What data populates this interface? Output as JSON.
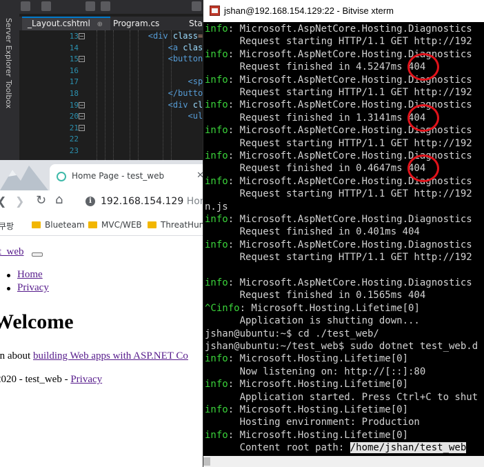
{
  "vs": {
    "tabs": [
      {
        "label": "_Layout.cshtml",
        "pin": "⊕",
        "close": "✕"
      },
      {
        "label": "Program.cs"
      },
      {
        "label": "Star"
      }
    ],
    "side_labels": [
      "Server Explorer",
      "Toolbox"
    ],
    "line_numbers": [
      "13",
      "14",
      "15",
      "16",
      "17",
      "18",
      "19",
      "20",
      "21",
      "22",
      "23"
    ],
    "code": [
      {
        "indent": "            ",
        "open": "<",
        "tag": "div",
        "attr": " class",
        "rest": "=\""
      },
      {
        "indent": "                ",
        "open": "<",
        "tag": "a",
        "attr": " class",
        "rest": "="
      },
      {
        "indent": "                ",
        "open": "<",
        "tag": "button",
        "attr": "",
        "rest": " c"
      },
      {
        "indent": "                        ",
        "open": "",
        "tag": "",
        "attr": "",
        "rest": "a"
      },
      {
        "indent": "                    ",
        "open": "<",
        "tag": "span",
        "attr": "",
        "rest": ""
      },
      {
        "indent": "                ",
        "open": "</",
        "tag": "button",
        "attr": "",
        "rest": ">"
      },
      {
        "indent": "                ",
        "open": "<",
        "tag": "div",
        "attr": " cla",
        "rest": ""
      },
      {
        "indent": "                    ",
        "open": "<",
        "tag": "ul",
        "attr": " c",
        "rest": ""
      },
      {
        "indent": "",
        "open": "",
        "tag": "",
        "attr": "",
        "rest": ""
      },
      {
        "indent": "",
        "open": "",
        "tag": "",
        "attr": "",
        "rest": ""
      },
      {
        "indent": "",
        "open": "",
        "tag": "",
        "attr": "",
        "rest": ""
      }
    ]
  },
  "browser": {
    "tab_title": "Home Page - test_web",
    "tab_close": "✕",
    "nav": {
      "back": "❮",
      "forward": "❯",
      "reload": "↻",
      "home": "⌂"
    },
    "url_host": "192.168.154.129",
    "url_rest": "Home",
    "bookmarks": [
      "쿠팡",
      "Blueteam",
      "MVC/WEB",
      "ThreatHunt"
    ],
    "page": {
      "brand": "st_web",
      "nav_links": [
        "Home",
        "Privacy"
      ],
      "heading": "Welcome",
      "learn_prefix": "arn about ",
      "learn_link": "building Web apps with ASP.NET Co",
      "footer_prefix": "2020 - test_web - ",
      "footer_link": "Privacy"
    }
  },
  "terminal": {
    "title": "jshan@192.168.154.129:22 - Bitvise xterm",
    "lines": [
      {
        "lvl": "info",
        "text": ": Microsoft.AspNetCore.Hosting.Diagnostics"
      },
      {
        "lvl": "",
        "text": "      Request starting HTTP/1.1 GET http://192"
      },
      {
        "lvl": "info",
        "text": ": Microsoft.AspNetCore.Hosting.Diagnostics"
      },
      {
        "lvl": "",
        "text": "      Request finished in 4.5247ms 404"
      },
      {
        "lvl": "info",
        "text": ": Microsoft.AspNetCore.Hosting.Diagnostics"
      },
      {
        "lvl": "",
        "text": "      Request starting HTTP/1.1 GET http://192"
      },
      {
        "lvl": "info",
        "text": ": Microsoft.AspNetCore.Hosting.Diagnostics"
      },
      {
        "lvl": "",
        "text": "      Request finished in 1.3141ms 404"
      },
      {
        "lvl": "info",
        "text": ": Microsoft.AspNetCore.Hosting.Diagnostics"
      },
      {
        "lvl": "",
        "text": "      Request starting HTTP/1.1 GET http://192"
      },
      {
        "lvl": "info",
        "text": ": Microsoft.AspNetCore.Hosting.Diagnostics"
      },
      {
        "lvl": "",
        "text": "      Request finished in 0.4647ms 404"
      },
      {
        "lvl": "info",
        "text": ": Microsoft.AspNetCore.Hosting.Diagnostics"
      },
      {
        "lvl": "",
        "text": "      Request starting HTTP/1.1 GET http://192"
      },
      {
        "lvl": "",
        "text": "n.js"
      },
      {
        "lvl": "info",
        "text": ": Microsoft.AspNetCore.Hosting.Diagnostics"
      },
      {
        "lvl": "",
        "text": "      Request finished in 0.401ms 404"
      },
      {
        "lvl": "info",
        "text": ": Microsoft.AspNetCore.Hosting.Diagnostics"
      },
      {
        "lvl": "",
        "text": "      Request starting HTTP/1.1 GET http://192"
      },
      {
        "lvl": "",
        "text": ""
      },
      {
        "lvl": "info",
        "text": ": Microsoft.AspNetCore.Hosting.Diagnostics"
      },
      {
        "lvl": "",
        "text": "      Request finished in 0.1565ms 404"
      },
      {
        "lvl": "^Cinfo",
        "text": ": Microsoft.Hosting.Lifetime[0]"
      },
      {
        "lvl": "",
        "text": "      Application is shutting down..."
      },
      {
        "lvl": "",
        "text": "jshan@ubuntu:~$ cd ./test_web/"
      },
      {
        "lvl": "",
        "text": "jshan@ubuntu:~/test_web$ sudo dotnet test_web.d"
      },
      {
        "lvl": "info",
        "text": ": Microsoft.Hosting.Lifetime[0]"
      },
      {
        "lvl": "",
        "text": "      Now listening on: http://[::]:80"
      },
      {
        "lvl": "info",
        "text": ": Microsoft.Hosting.Lifetime[0]"
      },
      {
        "lvl": "",
        "text": "      Application started. Press Ctrl+C to shut"
      },
      {
        "lvl": "info",
        "text": ": Microsoft.Hosting.Lifetime[0]"
      },
      {
        "lvl": "",
        "text": "      Hosting environment: Production"
      },
      {
        "lvl": "info",
        "text": ": Microsoft.Hosting.Lifetime[0]"
      },
      {
        "lvl": "",
        "text": "      Content root path: ",
        "hl": "/home/jshan/test_web"
      }
    ]
  }
}
